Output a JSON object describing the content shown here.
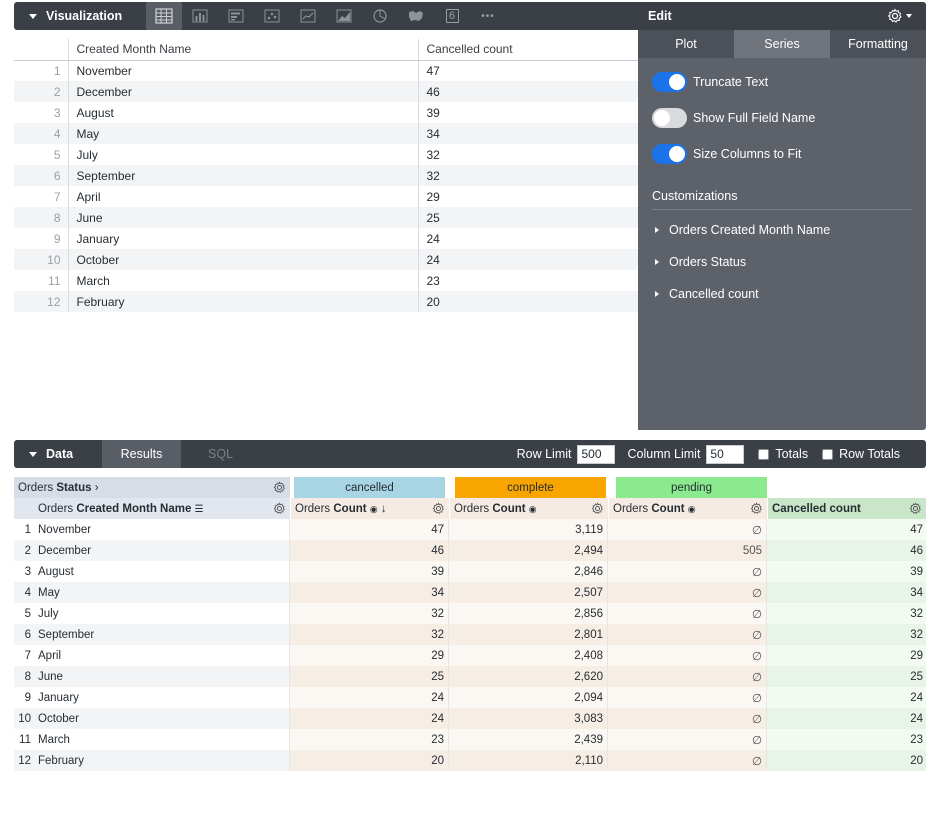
{
  "viz": {
    "title": "Visualization",
    "icons": [
      "table-icon",
      "bar-chart-icon",
      "column-chart-icon",
      "scatter-icon",
      "line-chart-icon",
      "area-chart-icon",
      "pie-chart-icon",
      "map-icon",
      "single-value-icon",
      "more-icon"
    ],
    "single_value_label": "6",
    "more_label": "•••",
    "table": {
      "headers": [
        "Created Month Name",
        "Cancelled count"
      ],
      "rows": [
        {
          "n": "1",
          "month": "November",
          "count": "47"
        },
        {
          "n": "2",
          "month": "December",
          "count": "46"
        },
        {
          "n": "3",
          "month": "August",
          "count": "39"
        },
        {
          "n": "4",
          "month": "May",
          "count": "34"
        },
        {
          "n": "5",
          "month": "July",
          "count": "32"
        },
        {
          "n": "6",
          "month": "September",
          "count": "32"
        },
        {
          "n": "7",
          "month": "April",
          "count": "29"
        },
        {
          "n": "8",
          "month": "June",
          "count": "25"
        },
        {
          "n": "9",
          "month": "January",
          "count": "24"
        },
        {
          "n": "10",
          "month": "October",
          "count": "24"
        },
        {
          "n": "11",
          "month": "March",
          "count": "23"
        },
        {
          "n": "12",
          "month": "February",
          "count": "20"
        }
      ]
    }
  },
  "edit": {
    "title": "Edit",
    "tabs": [
      "Plot",
      "Series",
      "Formatting"
    ],
    "active_tab": "Series",
    "toggles": [
      {
        "label": "Truncate Text",
        "on": true
      },
      {
        "label": "Show Full Field Name",
        "on": false
      },
      {
        "label": "Size Columns to Fit",
        "on": true
      }
    ],
    "customizations_title": "Customizations",
    "customizations": [
      "Orders Created Month Name",
      "Orders Status",
      "Cancelled count"
    ]
  },
  "data_bar": {
    "title": "Data",
    "tabs": [
      "Results",
      "SQL"
    ],
    "row_limit_label": "Row Limit",
    "row_limit_value": "500",
    "column_limit_label": "Column Limit",
    "column_limit_value": "50",
    "totals_label": "Totals",
    "row_totals_label": "Row Totals"
  },
  "results": {
    "pivot_label_prefix": "Orders",
    "pivot_label_field": "Status",
    "pivot_values": [
      "cancelled",
      "complete",
      "pending"
    ],
    "dim_prefix": "Orders",
    "dim_field": "Created Month Name",
    "measure_prefix": "Orders",
    "measure_field": "Count",
    "table_calc": "Cancelled count",
    "rows": [
      {
        "n": "1",
        "month": "November",
        "cancelled": "47",
        "complete": "3,119",
        "pending": "∅",
        "calc": "47"
      },
      {
        "n": "2",
        "month": "December",
        "cancelled": "46",
        "complete": "2,494",
        "pending": "505",
        "calc": "46"
      },
      {
        "n": "3",
        "month": "August",
        "cancelled": "39",
        "complete": "2,846",
        "pending": "∅",
        "calc": "39"
      },
      {
        "n": "4",
        "month": "May",
        "cancelled": "34",
        "complete": "2,507",
        "pending": "∅",
        "calc": "34"
      },
      {
        "n": "5",
        "month": "July",
        "cancelled": "32",
        "complete": "2,856",
        "pending": "∅",
        "calc": "32"
      },
      {
        "n": "6",
        "month": "September",
        "cancelled": "32",
        "complete": "2,801",
        "pending": "∅",
        "calc": "32"
      },
      {
        "n": "7",
        "month": "April",
        "cancelled": "29",
        "complete": "2,408",
        "pending": "∅",
        "calc": "29"
      },
      {
        "n": "8",
        "month": "June",
        "cancelled": "25",
        "complete": "2,620",
        "pending": "∅",
        "calc": "25"
      },
      {
        "n": "9",
        "month": "January",
        "cancelled": "24",
        "complete": "2,094",
        "pending": "∅",
        "calc": "24"
      },
      {
        "n": "10",
        "month": "October",
        "cancelled": "24",
        "complete": "3,083",
        "pending": "∅",
        "calc": "24"
      },
      {
        "n": "11",
        "month": "March",
        "cancelled": "23",
        "complete": "2,439",
        "pending": "∅",
        "calc": "23"
      },
      {
        "n": "12",
        "month": "February",
        "cancelled": "20",
        "complete": "2,110",
        "pending": "∅",
        "calc": "20"
      }
    ]
  },
  "colors": {
    "bar_bg": "#3b3f46",
    "panel_bg": "#5d6169",
    "toggle_on": "#1a73e8",
    "pivot_cancelled": "#a7d5e3",
    "pivot_complete": "#f9a500",
    "pivot_pending": "#8bea8e",
    "calc_header": "#c9e6c9"
  }
}
